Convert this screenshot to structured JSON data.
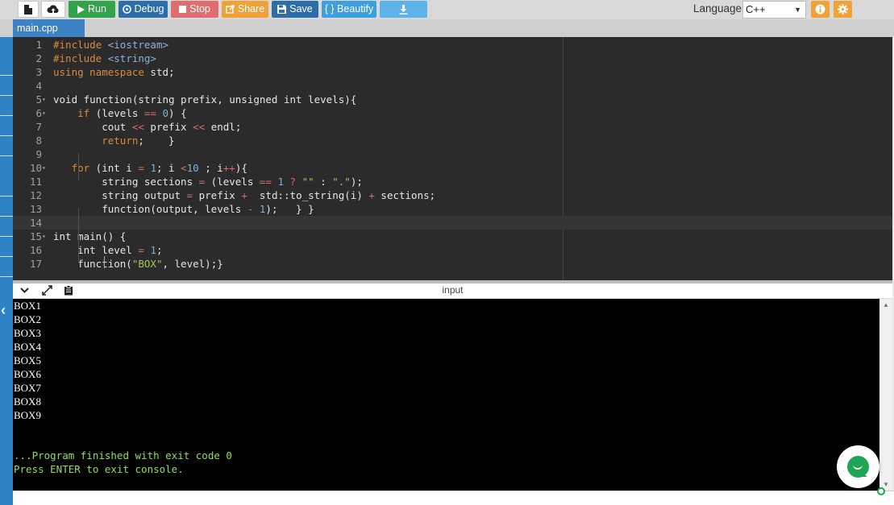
{
  "toolbar": {
    "run_label": "Run",
    "debug_label": "Debug",
    "stop_label": "Stop",
    "share_label": "Share",
    "save_label": "Save",
    "beautify_label": "{ } Beautify",
    "language_label": "Language",
    "language_value": "C++"
  },
  "tabs": [
    {
      "label": "main.cpp"
    }
  ],
  "editor": {
    "active_line": 14,
    "lines": [
      "#include <iostream>",
      "#include <string>",
      "using namespace std;",
      "",
      "void function(string prefix, unsigned int levels){",
      "    if (levels == 0) {",
      "        cout << prefix << endl;",
      "        return;    }",
      "",
      "   for (int i = 1; i <10 ; i++){",
      "        string sections = (levels == 1 ? \"\" : \".\");",
      "        string output = prefix +  std::to_string(i) + sections;",
      "        function(output, levels - 1);   } }",
      "",
      "int main() {",
      "    int level = 1;",
      "    function(\"BOX\", level);}"
    ]
  },
  "console": {
    "title": "input",
    "output_lines": [
      "BOX1",
      "BOX2",
      "BOX3",
      "BOX4",
      "BOX5",
      "BOX6",
      "BOX7",
      "BOX8",
      "BOX9"
    ],
    "status_lines": [
      "...Program finished with exit code 0",
      "Press ENTER to exit console."
    ]
  },
  "colors": {
    "run": "#31a34a",
    "debug": "#2d6ea8",
    "stop": "#e06d6d",
    "share": "#f0a238",
    "save": "#2d6ea8",
    "beautify": "#3d9ee0",
    "download": "#5fb2e8",
    "tab_active": "#3c82c4"
  }
}
